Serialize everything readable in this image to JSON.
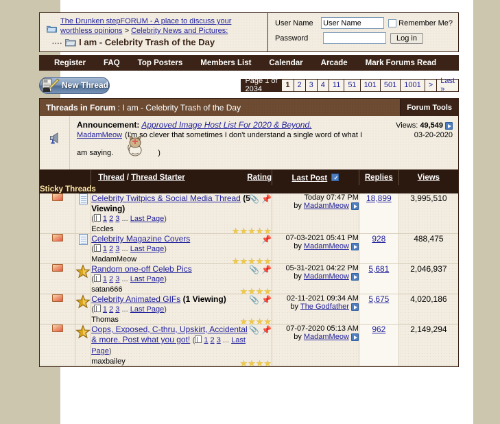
{
  "breadcrumb": {
    "link1": "The Drunken stepFORUM - A place to discuss your worthless opinions",
    "sep": ">",
    "link2": "Celebrity News and Pictures:",
    "current": "I am - Celebrity Trash of the Day"
  },
  "login": {
    "username_label": "User Name",
    "username_value": "User Name",
    "password_label": "Password",
    "password_value": "",
    "remember_label": "Remember Me?",
    "login_button": "Log in"
  },
  "nav": {
    "items": [
      {
        "label": "Register"
      },
      {
        "label": "FAQ"
      },
      {
        "label": "Top Posters"
      },
      {
        "label": "Members List"
      },
      {
        "label": "Calendar"
      },
      {
        "label": "Arcade"
      },
      {
        "label": "Mark Forums Read"
      }
    ]
  },
  "toolbar": {
    "new_thread_label": "New Thread"
  },
  "pager": {
    "label": "Page 1 of 2034",
    "pages": [
      "1",
      "2",
      "3",
      "4",
      "11",
      "51",
      "101",
      "501",
      "1001",
      ">",
      "Last »"
    ],
    "current": "1"
  },
  "panel": {
    "head_prefix": "Threads in Forum",
    "head_sep": " : ",
    "head_title": "I am - Celebrity Trash of the Day",
    "forum_tools": "Forum Tools"
  },
  "announcement": {
    "icon": "megaphone-icon",
    "label": "Announcement",
    "colon": ":",
    "title": "Approved Image Host List For 2020 & Beyond.",
    "views_label": "Views:",
    "views_value": "49,549",
    "author": "MadamMeow",
    "tagline_part1": "(I'm so clever that sometimes I don't understand a single word of what I",
    "tagline_part2": "am saying.",
    "tagline_end": ")",
    "date": "03-20-2020"
  },
  "table": {
    "headers": {
      "thread": "Thread",
      "slash": "/",
      "thread_starter": "Thread Starter",
      "rating": "Rating",
      "last_post": "Last Post",
      "replies": "Replies",
      "views": "Views"
    },
    "section_label": "Sticky Threads",
    "rows": [
      {
        "status_icon": "unread-envelope-icon",
        "type_icon": "document-icon",
        "title": "Celebrity Twitpics & Social Media Thread",
        "viewing": "(5 Viewing)",
        "pages_open": "(",
        "page_links": [
          "1",
          "2",
          "3"
        ],
        "pages_ellipsis": "...",
        "last_page": "Last Page",
        "pages_close": ")",
        "starter": "Eccles",
        "rating_stars": 5,
        "has_attachment": true,
        "is_pinned": true,
        "last_post_date": "Today 07:47 PM",
        "last_post_by_label": "by",
        "last_post_author": "MadamMeow",
        "replies": "18,899",
        "views": "3,995,510"
      },
      {
        "status_icon": "unread-envelope-icon",
        "type_icon": "document-icon",
        "title": "Celebrity Magazine Covers",
        "viewing": "",
        "pages_open": "(",
        "page_links": [
          "1",
          "2",
          "3"
        ],
        "pages_ellipsis": "...",
        "last_page": "Last Page",
        "pages_close": ")",
        "starter": "MadamMeow",
        "rating_stars": 5,
        "has_attachment": false,
        "is_pinned": true,
        "last_post_date": "07-03-2021 05:41 PM",
        "last_post_by_label": "by",
        "last_post_author": "MadamMeow",
        "replies": "928",
        "views": "488,475"
      },
      {
        "status_icon": "unread-envelope-icon",
        "type_icon": "gold-star-icon",
        "title": "Random one-off Celeb Pics",
        "viewing": "",
        "pages_open": "(",
        "page_links": [
          "1",
          "2",
          "3"
        ],
        "pages_ellipsis": "...",
        "last_page": "Last Page",
        "pages_close": ")",
        "starter": "satan666",
        "rating_stars": 4,
        "has_attachment": true,
        "is_pinned": true,
        "last_post_date": "05-31-2021 04:22 PM",
        "last_post_by_label": "by",
        "last_post_author": "MadamMeow",
        "replies": "5,681",
        "views": "2,046,937"
      },
      {
        "status_icon": "unread-envelope-icon",
        "type_icon": "gold-star-icon",
        "title": "Celebrity Animated GIFs",
        "viewing": "(1 Viewing)",
        "pages_open": "(",
        "page_links": [
          "1",
          "2",
          "3"
        ],
        "pages_ellipsis": "...",
        "last_page": "Last Page",
        "pages_close": ")",
        "starter": "Thomas",
        "rating_stars": 4,
        "has_attachment": true,
        "is_pinned": true,
        "last_post_date": "02-11-2021 09:34 AM",
        "last_post_by_label": "by",
        "last_post_author": "The Godfather",
        "replies": "5,675",
        "views": "4,020,186"
      },
      {
        "status_icon": "unread-envelope-icon",
        "type_icon": "gold-star-icon",
        "title": "Oops, Exposed, C-thru, Upskirt, Accidental & more. Post what you got!",
        "viewing": "",
        "pages_open": "(",
        "page_links": [
          "1",
          "2",
          "3"
        ],
        "pages_ellipsis": "...",
        "last_page": "Last Page",
        "pages_close": ")",
        "starter": "maxbailey",
        "rating_stars": 4,
        "has_attachment": true,
        "is_pinned": true,
        "last_post_date": "07-07-2020 05:13 AM",
        "last_post_by_label": "by",
        "last_post_author": "MadamMeow",
        "replies": "962",
        "views": "2,149,294"
      }
    ]
  },
  "colors": {
    "page_bg": "#cdc6ae",
    "dark_brown": "#3b2417",
    "header_brown": "#6b4a31",
    "row_bg": "#f2ece1",
    "link_blue": "#22229c",
    "star_gold": "#edc94e"
  }
}
